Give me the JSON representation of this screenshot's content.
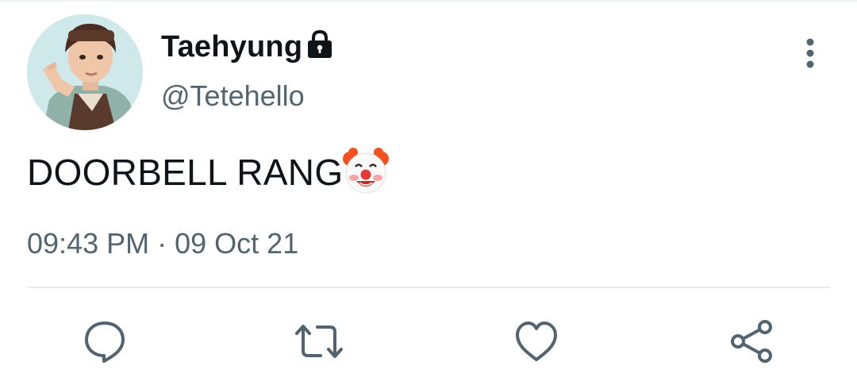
{
  "tweet": {
    "author": {
      "display_name": "Taehyung",
      "handle": "@Tetehello",
      "protected_icon": "lock-icon",
      "avatar": "profile-photo"
    },
    "text": "DOORBELL RANG",
    "emoji": "clown-face-emoji",
    "time": "09:43 PM",
    "separator": "·",
    "date": "09 Oct 21",
    "menu_icon": "more-vertical-icon"
  },
  "actions": [
    {
      "name": "reply",
      "icon": "speech-bubble-icon"
    },
    {
      "name": "retweet",
      "icon": "retweet-arrows-icon"
    },
    {
      "name": "like",
      "icon": "heart-icon"
    },
    {
      "name": "share",
      "icon": "share-nodes-icon"
    }
  ],
  "colors": {
    "text_primary": "#0f1419",
    "text_secondary": "#536471",
    "divider": "#e6ecf0",
    "icon": "#536471"
  }
}
